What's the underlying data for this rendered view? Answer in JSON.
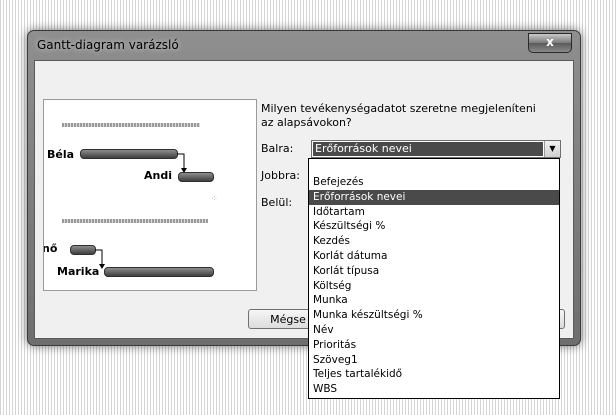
{
  "window": {
    "title": "Gantt-diagram varázsló",
    "close_label": "x"
  },
  "preview": {
    "resources": [
      "Béla",
      "Andi",
      "nő",
      "Marika"
    ]
  },
  "form": {
    "question": "Milyen tevékenységadatot szeretne megjeleníteni az alapsávokon?",
    "left_label": "Balra:",
    "right_label": "Jobbra:",
    "inside_label": "Belül:",
    "left_value": "Erőforrások nevei"
  },
  "buttons": {
    "cancel_label": "Mégse"
  },
  "dropdown": {
    "items": [
      "Befejezés",
      "Erőforrások nevei",
      "Időtartam",
      "Készültségi %",
      "Kezdés",
      "Korlát dátuma",
      "Korlát típusa",
      "Költség",
      "Munka",
      "Munka készültségi %",
      "Név",
      "Prioritás",
      "Szöveg1",
      "Teljes tartalékidő",
      "WBS"
    ],
    "selected_index": 1
  }
}
